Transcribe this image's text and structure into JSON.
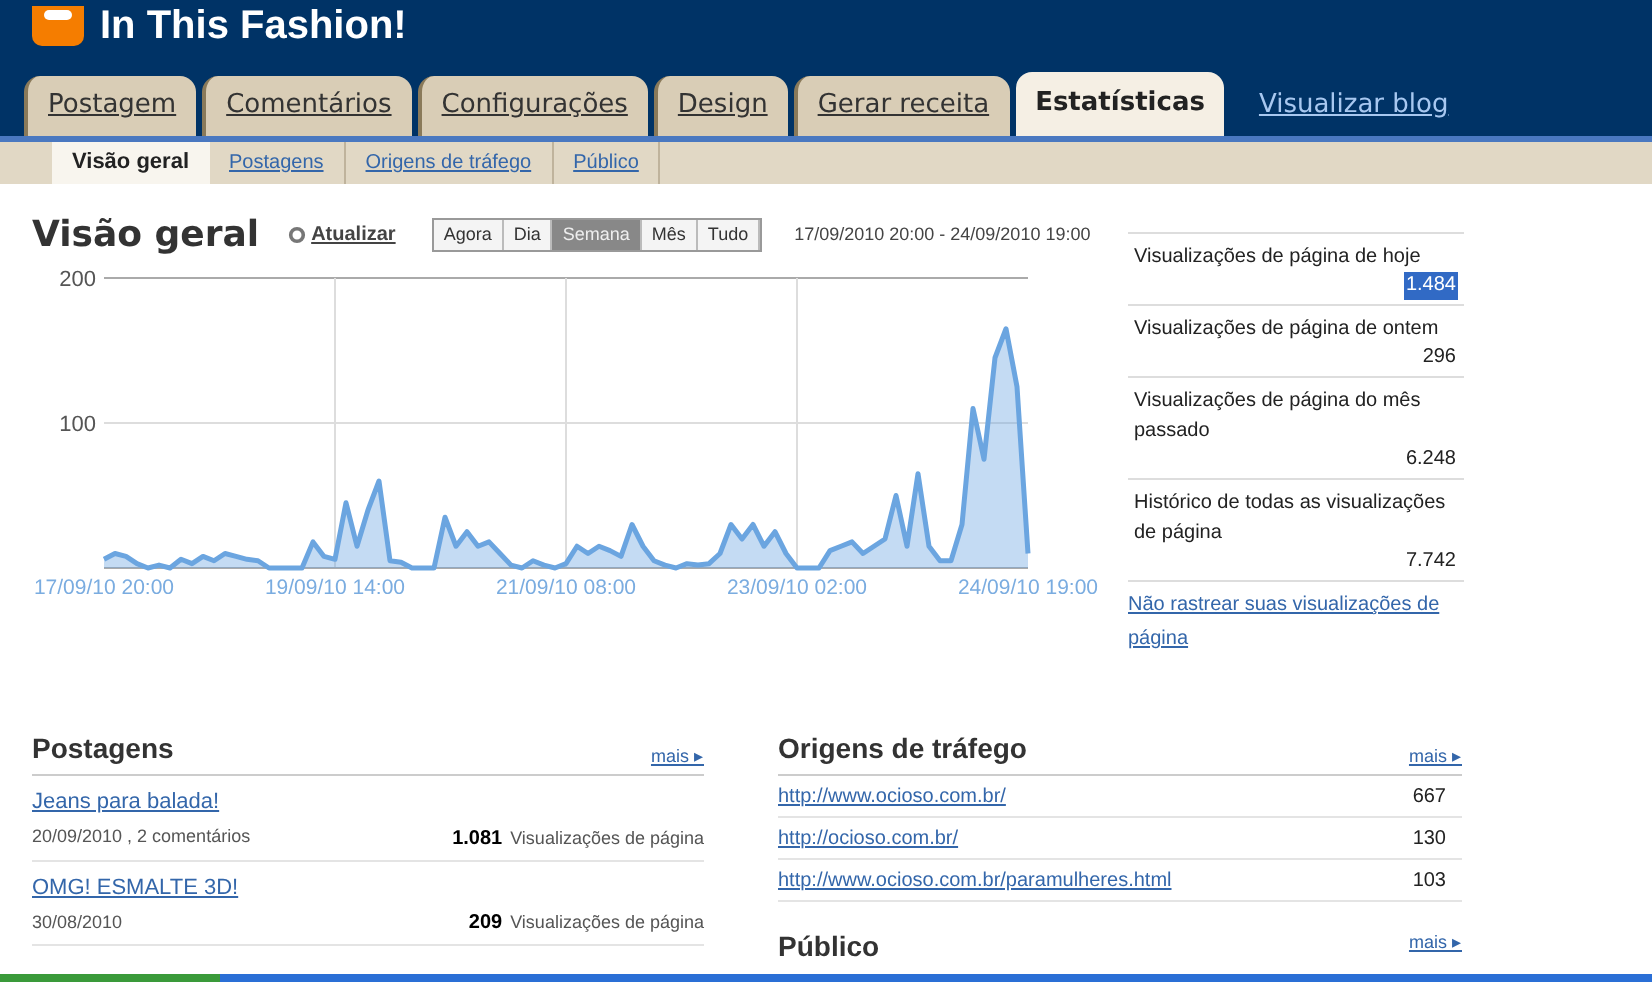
{
  "blog_title": "In This Fashion!",
  "tabs": [
    {
      "label": "Postagem",
      "selected": false
    },
    {
      "label": "Comentários",
      "selected": false
    },
    {
      "label": "Configurações",
      "selected": false
    },
    {
      "label": "Design",
      "selected": false
    },
    {
      "label": "Gerar receita",
      "selected": false
    },
    {
      "label": "Estatísticas",
      "selected": true
    }
  ],
  "view_blog_link": "Visualizar blog",
  "subtabs": [
    {
      "label": "Visão geral",
      "selected": true
    },
    {
      "label": "Postagens",
      "selected": false
    },
    {
      "label": "Origens de tráfego",
      "selected": false
    },
    {
      "label": "Público",
      "selected": false
    }
  ],
  "overview": {
    "heading": "Visão geral",
    "refresh_link": "Atualizar",
    "ranges": [
      {
        "label": "Agora",
        "selected": false
      },
      {
        "label": "Dia",
        "selected": false
      },
      {
        "label": "Semana",
        "selected": true
      },
      {
        "label": "Mês",
        "selected": false
      },
      {
        "label": "Tudo",
        "selected": false
      }
    ],
    "date_range": "17/09/2010 20:00 - 24/09/2010 19:00",
    "chart_data": {
      "type": "area",
      "categories": [
        "17/09/10 20:00",
        null,
        null,
        null,
        null,
        null,
        null,
        null,
        null,
        null,
        null,
        null,
        null,
        null,
        null,
        null,
        null,
        null,
        null,
        null,
        null,
        "19/09/10 14:00",
        null,
        null,
        null,
        null,
        null,
        null,
        null,
        null,
        null,
        null,
        null,
        null,
        null,
        null,
        null,
        null,
        null,
        null,
        null,
        null,
        "21/09/10 08:00",
        null,
        null,
        null,
        null,
        null,
        null,
        null,
        null,
        null,
        null,
        null,
        null,
        null,
        null,
        null,
        null,
        null,
        null,
        null,
        null,
        "23/09/10 02:00",
        null,
        null,
        null,
        null,
        null,
        null,
        null,
        null,
        null,
        null,
        null,
        null,
        null,
        null,
        null,
        null,
        null,
        null,
        null,
        null,
        "24/09/10 19:00"
      ],
      "series": [
        {
          "color": "#6ba5e0",
          "values": [
            6,
            10,
            8,
            3,
            0,
            2,
            0,
            6,
            3,
            8,
            5,
            10,
            8,
            6,
            5,
            0,
            0,
            0,
            0,
            18,
            8,
            6,
            45,
            15,
            40,
            60,
            5,
            4,
            0,
            0,
            0,
            35,
            15,
            25,
            15,
            18,
            10,
            2,
            0,
            5,
            2,
            0,
            3,
            15,
            10,
            15,
            12,
            8,
            30,
            15,
            5,
            2,
            0,
            3,
            2,
            3,
            10,
            30,
            20,
            30,
            15,
            25,
            10,
            0,
            0,
            0,
            12,
            15,
            18,
            10,
            15,
            20,
            50,
            15,
            65,
            15,
            5,
            5,
            30,
            110,
            75,
            145,
            165,
            125,
            10
          ]
        }
      ],
      "ylim": [
        0,
        200
      ],
      "grid": true,
      "yticks": [
        100,
        200
      ]
    }
  },
  "stats": [
    {
      "label": "Visualizações de página de hoje",
      "value": "1.484",
      "selected": true
    },
    {
      "label": "Visualizações de página de ontem",
      "value": "296",
      "selected": false
    },
    {
      "label": "Visualizações de página do mês passado",
      "value": "6.248",
      "selected": false
    },
    {
      "label": "Histórico de todas as visualizações de página",
      "value": "7.742",
      "selected": false
    }
  ],
  "dont_track_link": "Não rastrear suas visualizações de página",
  "posts": {
    "heading": "Postagens",
    "more": "mais ▸",
    "items": [
      {
        "title": "Jeans para balada!",
        "meta": "20/09/2010 , 2 comentários",
        "count": "1.081",
        "unit": "Visualizações de página"
      },
      {
        "title": "OMG! ESMALTE 3D!",
        "meta": "30/08/2010",
        "count": "209",
        "unit": "Visualizações de página"
      }
    ]
  },
  "traffic": {
    "heading": "Origens de tráfego",
    "more": "mais ▸",
    "items": [
      {
        "url": "http://www.ocioso.com.br/",
        "count": "667"
      },
      {
        "url": "http://ocioso.com.br/",
        "count": "130"
      },
      {
        "url": "http://www.ocioso.com.br/paramulheres.html",
        "count": "103"
      }
    ]
  },
  "audience": {
    "heading": "Público",
    "more": "mais ▸"
  }
}
